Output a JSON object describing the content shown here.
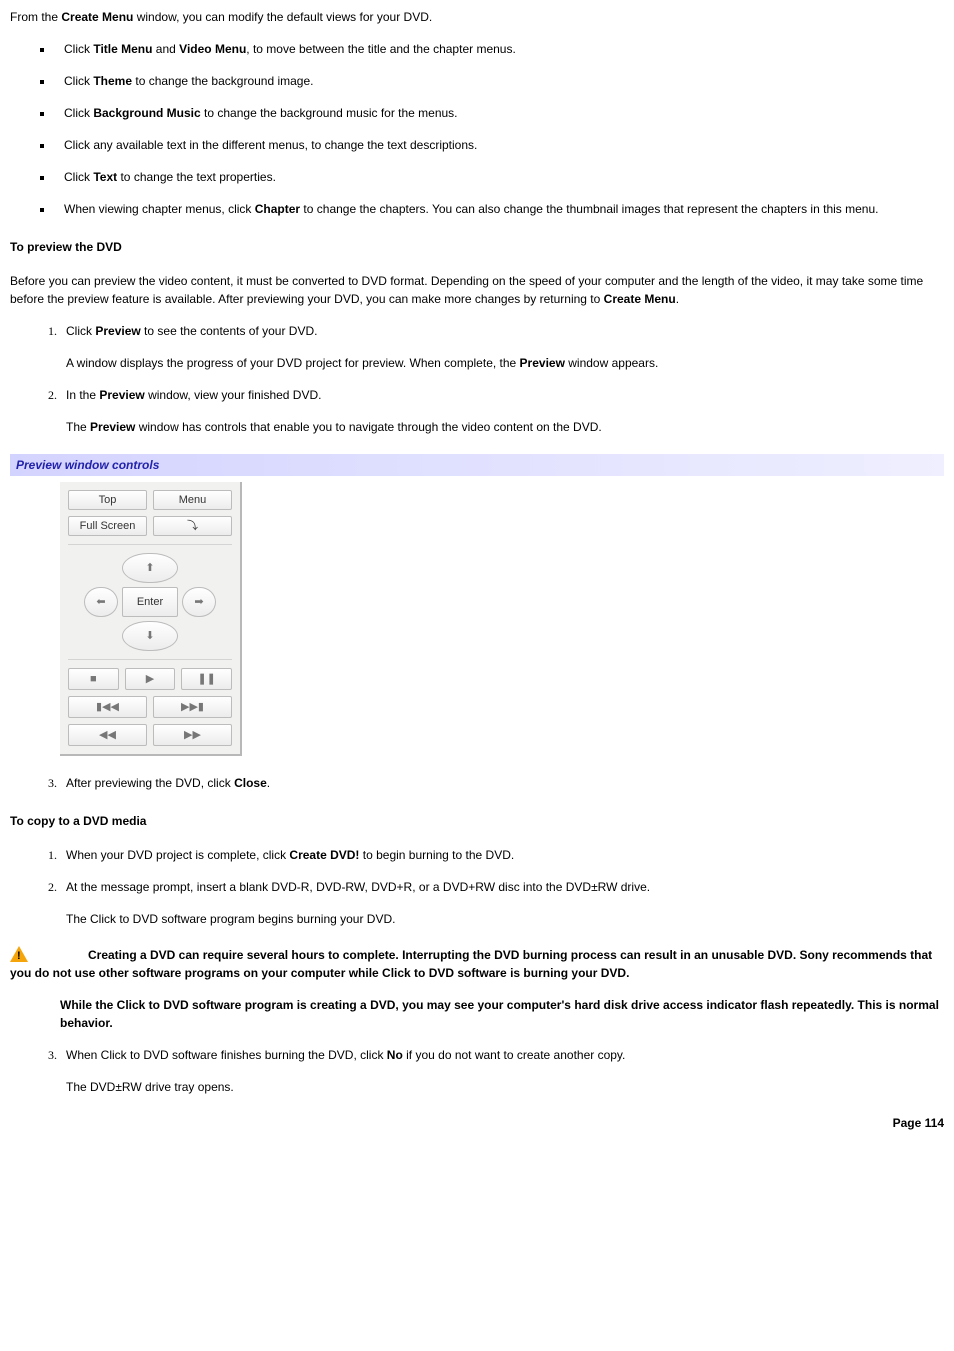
{
  "intro": {
    "prefix": "From the ",
    "bold": "Create Menu",
    "suffix": " window, you can modify the default views for your DVD."
  },
  "bullets": [
    {
      "pre": "Click ",
      "b1": "Title Menu",
      "mid": " and ",
      "b2": "Video Menu",
      "post": ", to move between the title and the chapter menus."
    },
    {
      "pre": "Click ",
      "b1": "Theme",
      "post": " to change the background image."
    },
    {
      "pre": "Click ",
      "b1": "Background Music",
      "post": " to change the background music for the menus."
    },
    {
      "plain": "Click any available text in the different menus, to change the text descriptions."
    },
    {
      "pre": "Click ",
      "b1": "Text",
      "post": " to change the text properties."
    },
    {
      "pre": "When viewing chapter menus, click ",
      "b1": "Chapter",
      "post": " to change the chapters. You can also change the thumbnail images that represent the chapters in this menu."
    }
  ],
  "preview": {
    "heading": "To preview the DVD",
    "para_pre": "Before you can preview the video content, it must be converted to DVD format. Depending on the speed of your computer and the length of the video, it may take some time before the preview feature is available. After previewing your DVD, you can make more changes by returning to ",
    "para_bold": "Create Menu",
    "para_post": ".",
    "step1_pre": "Click ",
    "step1_b": "Preview",
    "step1_post": " to see the contents of your DVD.",
    "step1_sub_pre": "A window displays the progress of your DVD project for preview. When complete, the ",
    "step1_sub_b": "Preview",
    "step1_sub_post": " window appears.",
    "step2_pre": "In the ",
    "step2_b": "Preview",
    "step2_post": " window, view your finished DVD.",
    "step2_sub_pre": "The ",
    "step2_sub_b": "Preview",
    "step2_sub_post": " window has controls that enable you to navigate through the video content on the DVD.",
    "caption": "Preview window controls",
    "step3_pre": "After previewing the DVD, click ",
    "step3_b": "Close",
    "step3_post": "."
  },
  "controls": {
    "top": "Top",
    "menu": "Menu",
    "fullscreen": "Full Screen",
    "enter": "Enter",
    "zoom_icon": "⤵",
    "up": "⬆",
    "down": "⬇",
    "left": "⬅",
    "right": "➡",
    "stop": "■",
    "play": "▶",
    "pause": "❚❚",
    "prev": "▮◀◀",
    "next": "▶▶▮",
    "rew": "◀◀",
    "ff": "▶▶"
  },
  "copy": {
    "heading": "To copy to a DVD media",
    "s1_pre": "When your DVD project is complete, click ",
    "s1_b": "Create DVD!",
    "s1_post": " to begin burning to the DVD.",
    "s2": "At the message prompt, insert a blank DVD-R, DVD-RW, DVD+R, or a DVD+RW disc into the DVD±RW drive.",
    "s2_sub": "The Click to DVD    software program begins burning your DVD.",
    "warn1": "Creating a DVD can require several hours to complete. Interrupting the DVD burning process can result in an unusable DVD. Sony recommends that you do not use other software programs on your computer while Click to DVD software is burning your DVD.",
    "warn2": "While the Click to DVD software program is creating a DVD, you may see your computer's hard disk drive access indicator flash repeatedly. This is normal behavior.",
    "s3_pre": "When Click to DVD software finishes burning the DVD, click ",
    "s3_b": "No",
    "s3_post": " if you do not want to create another copy.",
    "s3_sub": "The DVD±RW drive tray opens."
  },
  "footer": "Page 114"
}
